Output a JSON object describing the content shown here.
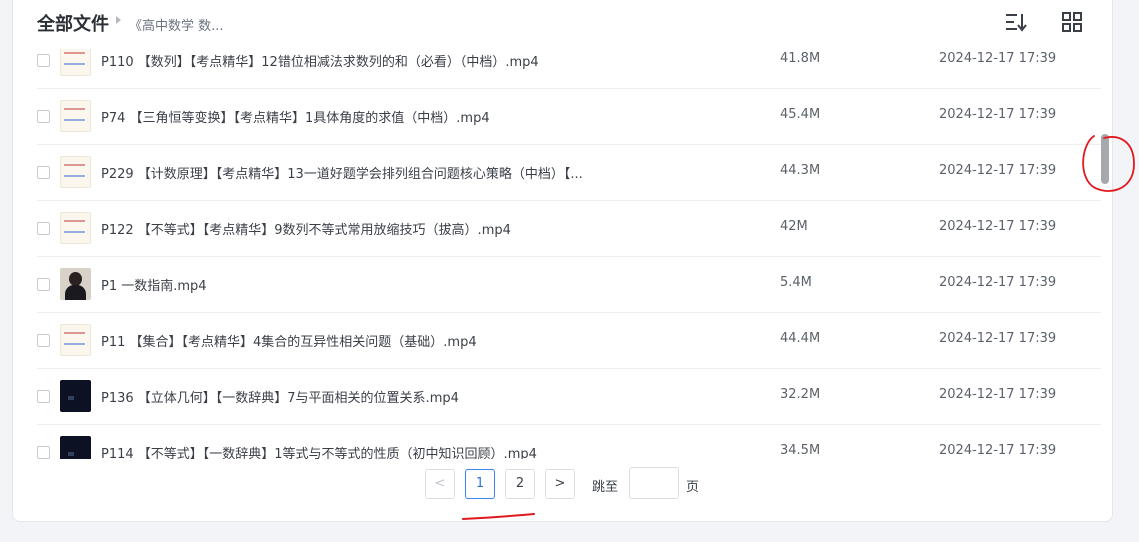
{
  "header": {
    "title": "全部文件",
    "breadcrumb": "《高中数学 数..."
  },
  "files": [
    {
      "name": "P110 【数列】【考点精华】12错位相减法求数列的和（必看）（中档）.mp4",
      "size": "41.8M",
      "date": "2024-12-17 17:39",
      "thumb": "paper"
    },
    {
      "name": "P74 【三角恒等变换】【考点精华】1具体角度的求值（中档）.mp4",
      "size": "45.4M",
      "date": "2024-12-17 17:39",
      "thumb": "paper"
    },
    {
      "name": "P229 【计数原理】【考点精华】13一道好题学会排列组合问题核心策略（中档）【...",
      "size": "44.3M",
      "date": "2024-12-17 17:39",
      "thumb": "paper"
    },
    {
      "name": "P122 【不等式】【考点精华】9数列不等式常用放缩技巧（拔高）.mp4",
      "size": "42M",
      "date": "2024-12-17 17:39",
      "thumb": "paper"
    },
    {
      "name": "P1 一数指南.mp4",
      "size": "5.4M",
      "date": "2024-12-17 17:39",
      "thumb": "person"
    },
    {
      "name": "P11 【集合】【考点精华】4集合的互异性相关问题（基础）.mp4",
      "size": "44.4M",
      "date": "2024-12-17 17:39",
      "thumb": "paper"
    },
    {
      "name": "P136 【立体几何】【一数辞典】7与平面相关的位置关系.mp4",
      "size": "32.2M",
      "date": "2024-12-17 17:39",
      "thumb": "dark"
    },
    {
      "name": "P114 【不等式】【一数辞典】1等式与不等式的性质（初中知识回顾）.mp4",
      "size": "34.5M",
      "date": "2024-12-17 17:39",
      "thumb": "dark"
    }
  ],
  "pagination": {
    "prev": "<",
    "pages": [
      "1",
      "2"
    ],
    "current": "1",
    "next": ">",
    "jump_label": "跳至",
    "jump_value": "",
    "page_suffix": "页"
  },
  "colors": {
    "accent": "#2f6fe4",
    "annotation": "#e0191f"
  },
  "icons": {
    "sort": "sort-icon",
    "view": "grid-view-icon"
  }
}
